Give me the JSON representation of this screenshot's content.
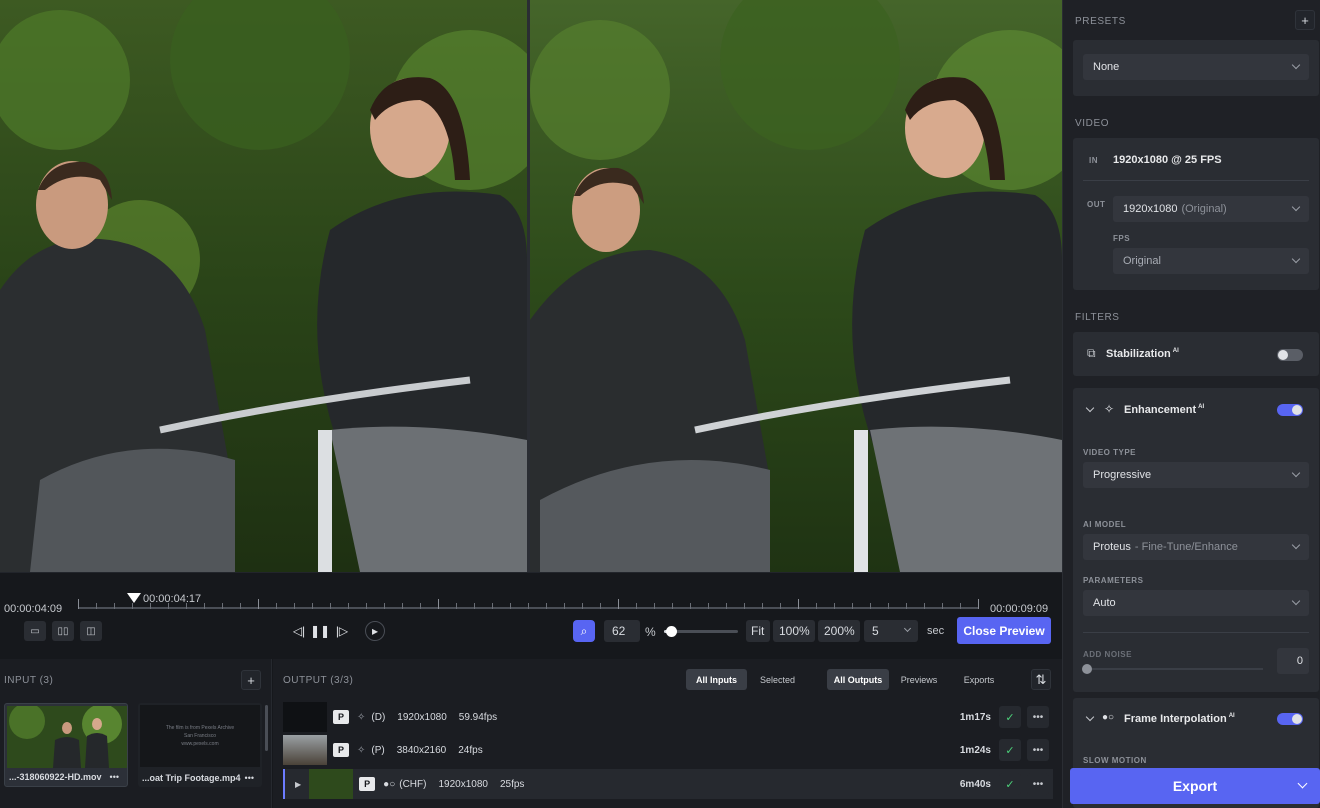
{
  "timeline": {
    "start_time": "00:00:04:09",
    "playhead_time": "00:00:04:17",
    "end_time": "00:00:09:09",
    "view_buttons": [
      "▭",
      "▯▯",
      "◫"
    ],
    "zoom_value": "62",
    "zoom_unit": "%",
    "zoom_slider_fraction": 0.05,
    "fit_label": "Fit",
    "preset_100": "100%",
    "preset_200": "200%",
    "seconds_value": "5",
    "seconds_unit": "sec",
    "close_preview_label": "Close Preview"
  },
  "input": {
    "title": "INPUT (3)",
    "files": [
      {
        "name": "...-318060922-HD.mov"
      },
      {
        "name": "...oat Trip Footage.mp4",
        "thumb_line1": "The film is from Pexels Archive",
        "thumb_line2": "San Francisco",
        "thumb_line3": "www.pexels.com"
      }
    ]
  },
  "output": {
    "title": "OUTPUT (3/3)",
    "filter_tabs": [
      "All Inputs",
      "Selected"
    ],
    "view_tabs": [
      "All Outputs",
      "Previews",
      "Exports"
    ],
    "rows": [
      {
        "badge": "P",
        "code": "(D)",
        "resolution": "1920x1080",
        "fps": "59.94fps",
        "duration": "1m17s"
      },
      {
        "badge": "P",
        "code": "(P)",
        "resolution": "3840x2160",
        "fps": "24fps",
        "duration": "1m24s"
      },
      {
        "badge": "P",
        "code": "(CHF)",
        "resolution": "1920x1080",
        "fps": "25fps",
        "duration": "6m40s"
      }
    ]
  },
  "sidebar": {
    "presets_title": "PRESETS",
    "preset_value": "None",
    "video_title": "VIDEO",
    "in_label": "IN",
    "in_value": "1920x1080 @ 25 FPS",
    "out_label": "OUT",
    "out_value": "1920x1080",
    "out_note": "(Original)",
    "fps_label": "FPS",
    "fps_value": "Original",
    "filters_title": "FILTERS",
    "stabilization": {
      "label": "Stabilization",
      "ai": "AI",
      "enabled": false
    },
    "enhancement": {
      "label": "Enhancement",
      "ai": "AI",
      "enabled": true,
      "video_type_label": "VIDEO TYPE",
      "video_type": "Progressive",
      "ai_model_label": "AI MODEL",
      "ai_model": "Proteus",
      "ai_model_sub": "- Fine-Tune/Enhance",
      "parameters_label": "PARAMETERS",
      "parameters": "Auto",
      "add_noise_label": "ADD NOISE",
      "add_noise": "0"
    },
    "frame_interpolation": {
      "label": "Frame Interpolation",
      "ai": "AI",
      "enabled": true,
      "slow_motion_label": "SLOW MOTION"
    },
    "export_label": "Export"
  },
  "colors": {
    "accent": "#5865f2",
    "toggle_on": "#5865f2",
    "toggle_off": "#5a5e66",
    "check": "#4cd17a"
  }
}
